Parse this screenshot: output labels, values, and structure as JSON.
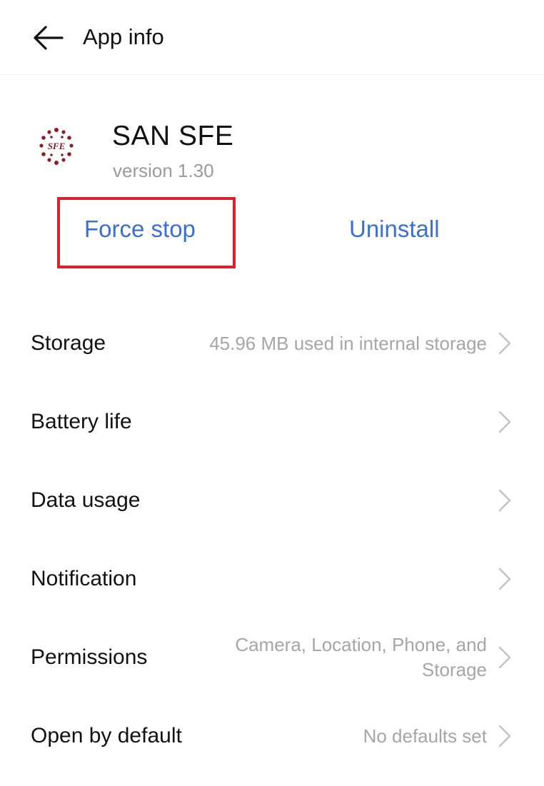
{
  "header": {
    "title": "App info",
    "back_icon": "arrow-left-icon"
  },
  "app": {
    "name": "SAN SFE",
    "version": "version 1.30",
    "icon_text": "SFE",
    "icon_color": "#8b1e24"
  },
  "actions": {
    "force_stop": "Force stop",
    "uninstall": "Uninstall",
    "accent_color": "#3a6fd8",
    "highlight_color": "#d9222b"
  },
  "settings": [
    {
      "label": "Storage",
      "value": "45.96 MB used in internal storage"
    },
    {
      "label": "Battery life",
      "value": ""
    },
    {
      "label": "Data usage",
      "value": ""
    },
    {
      "label": "Notification",
      "value": ""
    },
    {
      "label": "Permissions",
      "value": "Camera, Location, Phone, and Storage"
    },
    {
      "label": "Open by default",
      "value": "No defaults set"
    }
  ]
}
